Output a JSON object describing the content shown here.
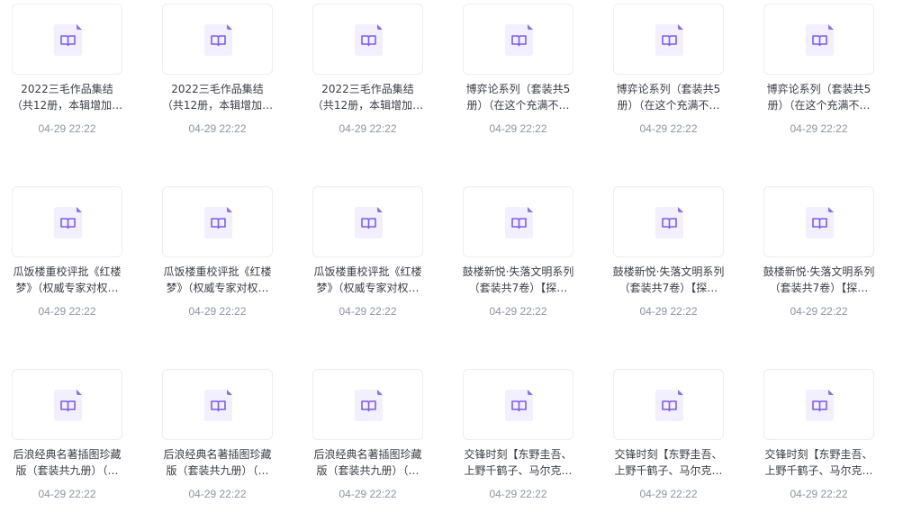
{
  "colors": {
    "icon_fill": "#f2effe",
    "icon_fold": "#8b6ff0",
    "icon_stroke": "#7c5cf2",
    "title_text": "#3b3d45",
    "time_text": "#8f949e"
  },
  "files": [
    {
      "icon": "book-file-icon",
      "title_line1": "2022三毛作品集结",
      "title_line2": "（共12册，本辑增加…",
      "time": "04-29 22:22"
    },
    {
      "icon": "book-file-icon",
      "title_line1": "2022三毛作品集结",
      "title_line2": "（共12册，本辑增加…",
      "time": "04-29 22:22"
    },
    {
      "icon": "book-file-icon",
      "title_line1": "2022三毛作品集结",
      "title_line2": "（共12册，本辑增加…",
      "time": "04-29 22:22"
    },
    {
      "icon": "book-file-icon",
      "title_line1": "博弈论系列（套装共5",
      "title_line2": "册）（在这个充满不…",
      "time": "04-29 22:22"
    },
    {
      "icon": "book-file-icon",
      "title_line1": "博弈论系列（套装共5",
      "title_line2": "册）（在这个充满不…",
      "time": "04-29 22:22"
    },
    {
      "icon": "book-file-icon",
      "title_line1": "博弈论系列（套装共5",
      "title_line2": "册）（在这个充满不…",
      "time": "04-29 22:22"
    },
    {
      "icon": "book-file-icon",
      "title_line1": "瓜饭楼重校评批《红楼",
      "title_line2": "梦》（权威专家对权…",
      "time": "04-29 22:22"
    },
    {
      "icon": "book-file-icon",
      "title_line1": "瓜饭楼重校评批《红楼",
      "title_line2": "梦》（权威专家对权…",
      "time": "04-29 22:22"
    },
    {
      "icon": "book-file-icon",
      "title_line1": "瓜饭楼重校评批《红楼",
      "title_line2": "梦》（权威专家对权…",
      "time": "04-29 22:22"
    },
    {
      "icon": "book-file-icon",
      "title_line1": "鼓楼新悦·失落文明系列",
      "title_line2": "（套装共7卷）【探…",
      "time": "04-29 22:22"
    },
    {
      "icon": "book-file-icon",
      "title_line1": "鼓楼新悦·失落文明系列",
      "title_line2": "（套装共7卷）【探…",
      "time": "04-29 22:22"
    },
    {
      "icon": "book-file-icon",
      "title_line1": "鼓楼新悦·失落文明系列",
      "title_line2": "（套装共7卷）【探…",
      "time": "04-29 22:22"
    },
    {
      "icon": "book-file-icon",
      "title_line1": "后浪经典名著插图珍藏",
      "title_line2": "版（套装共九册）（…",
      "time": "04-29 22:22"
    },
    {
      "icon": "book-file-icon",
      "title_line1": "后浪经典名著插图珍藏",
      "title_line2": "版（套装共九册）（…",
      "time": "04-29 22:22"
    },
    {
      "icon": "book-file-icon",
      "title_line1": "后浪经典名著插图珍藏",
      "title_line2": "版（套装共九册）（…",
      "time": "04-29 22:22"
    },
    {
      "icon": "book-file-icon",
      "title_line1": "交锋时刻【东野圭吾、",
      "title_line2": "上野千鹤子、马尔克…",
      "time": "04-29 22:22"
    },
    {
      "icon": "book-file-icon",
      "title_line1": "交锋时刻【东野圭吾、",
      "title_line2": "上野千鹤子、马尔克…",
      "time": "04-29 22:22"
    },
    {
      "icon": "book-file-icon",
      "title_line1": "交锋时刻【东野圭吾、",
      "title_line2": "上野千鹤子、马尔克…",
      "time": "04-29 22:22"
    }
  ]
}
